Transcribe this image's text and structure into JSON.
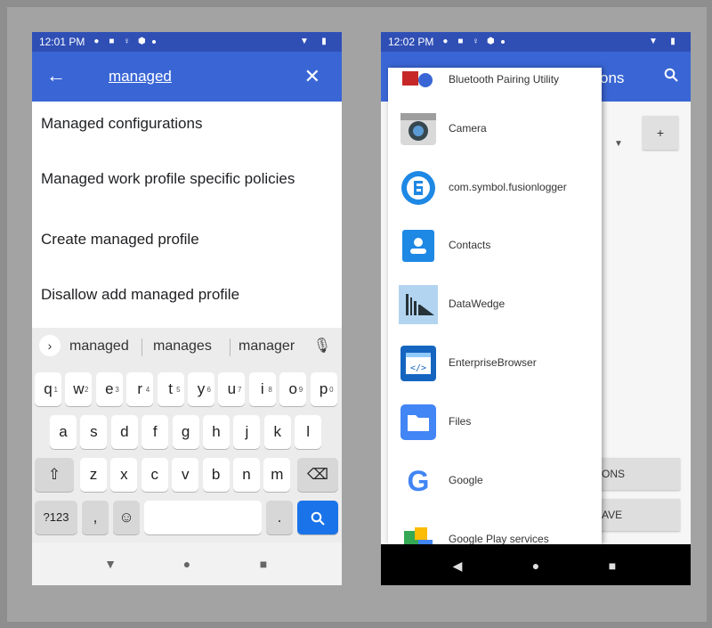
{
  "left_phone": {
    "status_time": "12:01 PM",
    "search_query": "managed",
    "results": [
      "Managed configurations",
      "Managed work profile specific policies",
      "Create managed profile",
      "Disallow add managed profile"
    ],
    "suggestions": [
      "managed",
      "manages",
      "manager"
    ],
    "keyboard": {
      "row1": [
        {
          "key": "q",
          "sup": "1"
        },
        {
          "key": "w",
          "sup": "2"
        },
        {
          "key": "e",
          "sup": "3"
        },
        {
          "key": "r",
          "sup": "4"
        },
        {
          "key": "t",
          "sup": "5"
        },
        {
          "key": "y",
          "sup": "6"
        },
        {
          "key": "u",
          "sup": "7"
        },
        {
          "key": "i",
          "sup": "8"
        },
        {
          "key": "o",
          "sup": "9"
        },
        {
          "key": "p",
          "sup": "0"
        }
      ],
      "row2": [
        "a",
        "s",
        "d",
        "f",
        "g",
        "h",
        "j",
        "k",
        "l"
      ],
      "row3": [
        "z",
        "x",
        "c",
        "v",
        "b",
        "n",
        "m"
      ],
      "symbols_label": "?123",
      "comma": ",",
      "period": "."
    }
  },
  "right_phone": {
    "status_time": "12:02 PM",
    "title_partial": "ons",
    "bg_button_1": "ONS",
    "bg_button_2": "AVE",
    "plus": "+",
    "apps": [
      {
        "name": "Bluetooth Pairing Utility",
        "icon": "bluetooth-pairing-icon"
      },
      {
        "name": "Camera",
        "icon": "camera-icon"
      },
      {
        "name": "com.symbol.fusionlogger",
        "icon": "fusionlogger-icon"
      },
      {
        "name": "Contacts",
        "icon": "contacts-icon"
      },
      {
        "name": "DataWedge",
        "icon": "datawedge-icon"
      },
      {
        "name": "EnterpriseBrowser",
        "icon": "enterprise-browser-icon"
      },
      {
        "name": "Files",
        "icon": "files-icon"
      },
      {
        "name": "Google",
        "icon": "google-icon"
      },
      {
        "name": "Google Play services",
        "icon": "play-services-icon"
      }
    ]
  },
  "colors": {
    "toolbar_blue": "#3a66d5",
    "status_blue": "#2f4fb5",
    "keyboard_bg": "#ececec",
    "enter_key_blue": "#1a73e8"
  }
}
